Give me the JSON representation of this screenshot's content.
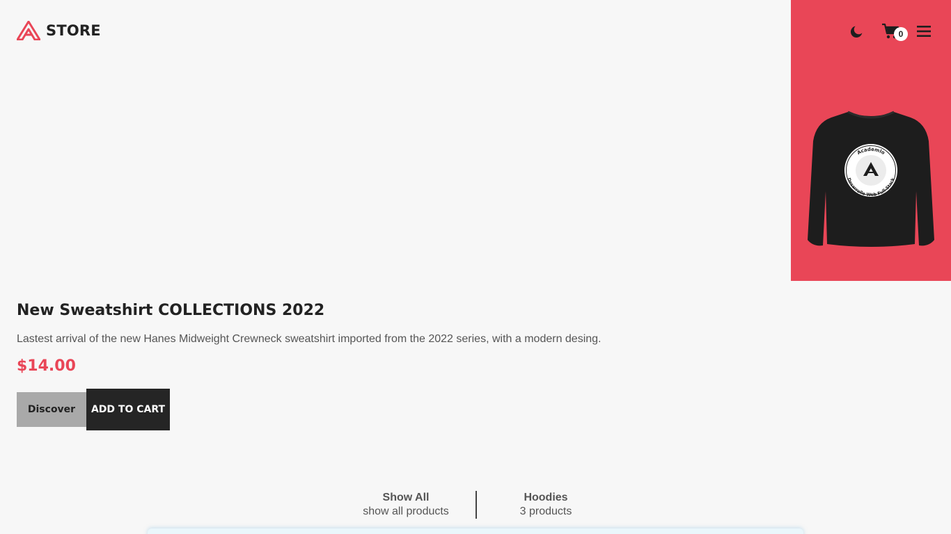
{
  "header": {
    "brand": "STORE",
    "cart_count": "0",
    "icons": [
      "moon-icon",
      "cart-icon",
      "menu-icon"
    ]
  },
  "hero": {
    "panel_color": "#e94657",
    "image": "black-sweatshirt-academlo",
    "image_text_top": "Academlo",
    "image_text_bottom": "Desarrollo Web Full-Stack"
  },
  "product": {
    "title": "New Sweatshirt COLLECTIONS 2022",
    "description": "Lastest arrival of the new Hanes Midweight Crewneck sweatshirt imported from the 2022 series, with a modern desing.",
    "price": "$14.00",
    "discover_label": "Discover",
    "add_to_cart_label": "ADD TO CART"
  },
  "filters": [
    {
      "name": "Show All",
      "count": "show all products"
    },
    {
      "name": "Hoodies",
      "count": "3 products"
    }
  ],
  "colors": {
    "accent": "#e94657",
    "background": "#f7f7f7",
    "dark": "#252525"
  }
}
